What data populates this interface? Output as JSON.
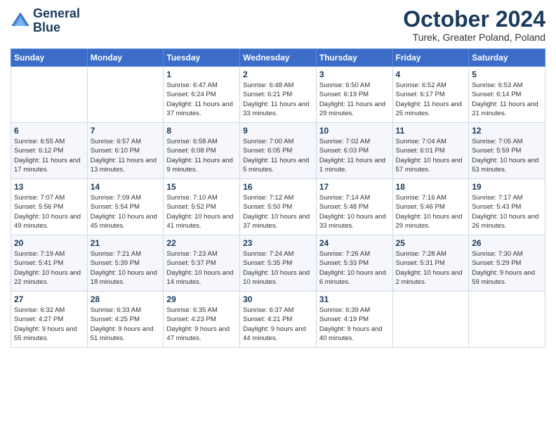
{
  "logo": {
    "line1": "General",
    "line2": "Blue"
  },
  "title": "October 2024",
  "location": "Turek, Greater Poland, Poland",
  "days_of_week": [
    "Sunday",
    "Monday",
    "Tuesday",
    "Wednesday",
    "Thursday",
    "Friday",
    "Saturday"
  ],
  "weeks": [
    [
      {
        "day": "",
        "info": ""
      },
      {
        "day": "",
        "info": ""
      },
      {
        "day": "1",
        "info": "Sunrise: 6:47 AM\nSunset: 6:24 PM\nDaylight: 11 hours and 37 minutes."
      },
      {
        "day": "2",
        "info": "Sunrise: 6:48 AM\nSunset: 6:21 PM\nDaylight: 11 hours and 33 minutes."
      },
      {
        "day": "3",
        "info": "Sunrise: 6:50 AM\nSunset: 6:19 PM\nDaylight: 11 hours and 29 minutes."
      },
      {
        "day": "4",
        "info": "Sunrise: 6:52 AM\nSunset: 6:17 PM\nDaylight: 11 hours and 25 minutes."
      },
      {
        "day": "5",
        "info": "Sunrise: 6:53 AM\nSunset: 6:14 PM\nDaylight: 11 hours and 21 minutes."
      }
    ],
    [
      {
        "day": "6",
        "info": "Sunrise: 6:55 AM\nSunset: 6:12 PM\nDaylight: 11 hours and 17 minutes."
      },
      {
        "day": "7",
        "info": "Sunrise: 6:57 AM\nSunset: 6:10 PM\nDaylight: 11 hours and 13 minutes."
      },
      {
        "day": "8",
        "info": "Sunrise: 6:58 AM\nSunset: 6:08 PM\nDaylight: 11 hours and 9 minutes."
      },
      {
        "day": "9",
        "info": "Sunrise: 7:00 AM\nSunset: 6:05 PM\nDaylight: 11 hours and 5 minutes."
      },
      {
        "day": "10",
        "info": "Sunrise: 7:02 AM\nSunset: 6:03 PM\nDaylight: 11 hours and 1 minute."
      },
      {
        "day": "11",
        "info": "Sunrise: 7:04 AM\nSunset: 6:01 PM\nDaylight: 10 hours and 57 minutes."
      },
      {
        "day": "12",
        "info": "Sunrise: 7:05 AM\nSunset: 5:59 PM\nDaylight: 10 hours and 53 minutes."
      }
    ],
    [
      {
        "day": "13",
        "info": "Sunrise: 7:07 AM\nSunset: 5:56 PM\nDaylight: 10 hours and 49 minutes."
      },
      {
        "day": "14",
        "info": "Sunrise: 7:09 AM\nSunset: 5:54 PM\nDaylight: 10 hours and 45 minutes."
      },
      {
        "day": "15",
        "info": "Sunrise: 7:10 AM\nSunset: 5:52 PM\nDaylight: 10 hours and 41 minutes."
      },
      {
        "day": "16",
        "info": "Sunrise: 7:12 AM\nSunset: 5:50 PM\nDaylight: 10 hours and 37 minutes."
      },
      {
        "day": "17",
        "info": "Sunrise: 7:14 AM\nSunset: 5:48 PM\nDaylight: 10 hours and 33 minutes."
      },
      {
        "day": "18",
        "info": "Sunrise: 7:16 AM\nSunset: 5:46 PM\nDaylight: 10 hours and 29 minutes."
      },
      {
        "day": "19",
        "info": "Sunrise: 7:17 AM\nSunset: 5:43 PM\nDaylight: 10 hours and 26 minutes."
      }
    ],
    [
      {
        "day": "20",
        "info": "Sunrise: 7:19 AM\nSunset: 5:41 PM\nDaylight: 10 hours and 22 minutes."
      },
      {
        "day": "21",
        "info": "Sunrise: 7:21 AM\nSunset: 5:39 PM\nDaylight: 10 hours and 18 minutes."
      },
      {
        "day": "22",
        "info": "Sunrise: 7:23 AM\nSunset: 5:37 PM\nDaylight: 10 hours and 14 minutes."
      },
      {
        "day": "23",
        "info": "Sunrise: 7:24 AM\nSunset: 5:35 PM\nDaylight: 10 hours and 10 minutes."
      },
      {
        "day": "24",
        "info": "Sunrise: 7:26 AM\nSunset: 5:33 PM\nDaylight: 10 hours and 6 minutes."
      },
      {
        "day": "25",
        "info": "Sunrise: 7:28 AM\nSunset: 5:31 PM\nDaylight: 10 hours and 2 minutes."
      },
      {
        "day": "26",
        "info": "Sunrise: 7:30 AM\nSunset: 5:29 PM\nDaylight: 9 hours and 59 minutes."
      }
    ],
    [
      {
        "day": "27",
        "info": "Sunrise: 6:32 AM\nSunset: 4:27 PM\nDaylight: 9 hours and 55 minutes."
      },
      {
        "day": "28",
        "info": "Sunrise: 6:33 AM\nSunset: 4:25 PM\nDaylight: 9 hours and 51 minutes."
      },
      {
        "day": "29",
        "info": "Sunrise: 6:35 AM\nSunset: 4:23 PM\nDaylight: 9 hours and 47 minutes."
      },
      {
        "day": "30",
        "info": "Sunrise: 6:37 AM\nSunset: 4:21 PM\nDaylight: 9 hours and 44 minutes."
      },
      {
        "day": "31",
        "info": "Sunrise: 6:39 AM\nSunset: 4:19 PM\nDaylight: 9 hours and 40 minutes."
      },
      {
        "day": "",
        "info": ""
      },
      {
        "day": "",
        "info": ""
      }
    ]
  ]
}
